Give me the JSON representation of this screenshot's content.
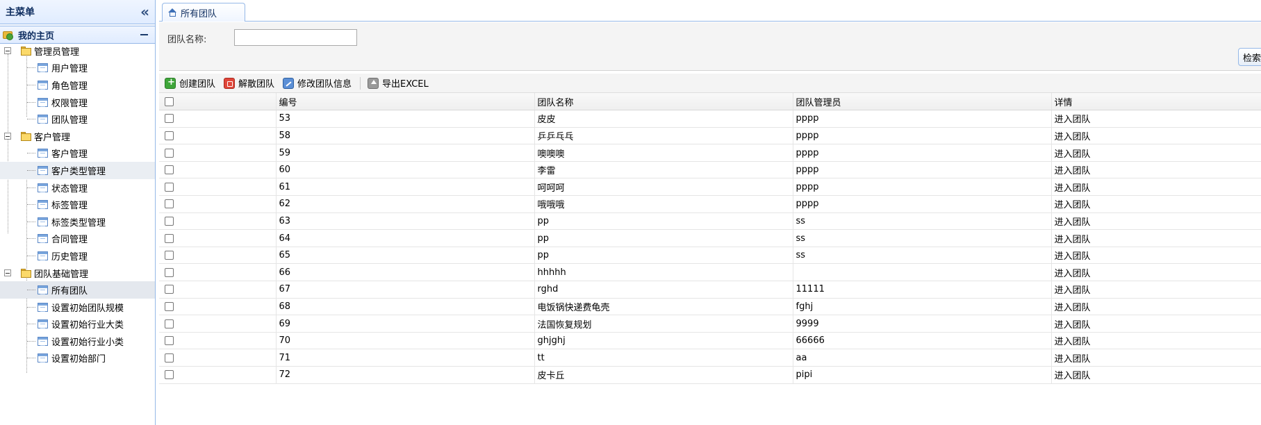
{
  "sidebar": {
    "title": "主菜单",
    "home_label": "我的主页",
    "groups": [
      {
        "label": "管理员管理",
        "items": [
          "用户管理",
          "角色管理",
          "权限管理",
          "团队管理"
        ]
      },
      {
        "label": "客户管理",
        "items": [
          "客户管理",
          "客户类型管理",
          "状态管理",
          "标签管理",
          "标签类型管理",
          "合同管理",
          "历史管理"
        ]
      },
      {
        "label": "团队基础管理",
        "items": [
          "所有团队",
          "设置初始团队规模",
          "设置初始行业大类",
          "设置初始行业小类",
          "设置初始部门"
        ]
      }
    ]
  },
  "tabs": [
    {
      "label": "所有团队"
    }
  ],
  "search": {
    "label": "团队名称:",
    "value": "",
    "button": "检索"
  },
  "toolbar": {
    "create": "创建团队",
    "dissolve": "解散团队",
    "edit": "修改团队信息",
    "export": "导出EXCEL"
  },
  "table": {
    "columns": [
      "编号",
      "团队名称",
      "团队管理员",
      "详情"
    ],
    "rows": [
      [
        "53",
        "皮皮",
        "pppp",
        "进入团队"
      ],
      [
        "58",
        "乒乒乓乓",
        "pppp",
        "进入团队"
      ],
      [
        "59",
        "噢噢噢",
        "pppp",
        "进入团队"
      ],
      [
        "60",
        "李雷",
        "pppp",
        "进入团队"
      ],
      [
        "61",
        "呵呵呵",
        "pppp",
        "进入团队"
      ],
      [
        "62",
        "哦哦哦",
        "pppp",
        "进入团队"
      ],
      [
        "63",
        "pp",
        "ss",
        "进入团队"
      ],
      [
        "64",
        "pp",
        "ss",
        "进入团队"
      ],
      [
        "65",
        "pp",
        "ss",
        "进入团队"
      ],
      [
        "66",
        "hhhhh",
        "",
        "进入团队"
      ],
      [
        "67",
        "rghd",
        "11111",
        "进入团队"
      ],
      [
        "68",
        "电饭锅快递费龟壳",
        "fghj",
        "进入团队"
      ],
      [
        "69",
        "法国恢复规划",
        "9999",
        "进入团队"
      ],
      [
        "70",
        "ghjghj",
        "66666",
        "进入团队"
      ],
      [
        "71",
        "tt",
        "aa",
        "进入团队"
      ],
      [
        "72",
        "皮卡丘",
        "pipi",
        "进入团队"
      ]
    ]
  }
}
